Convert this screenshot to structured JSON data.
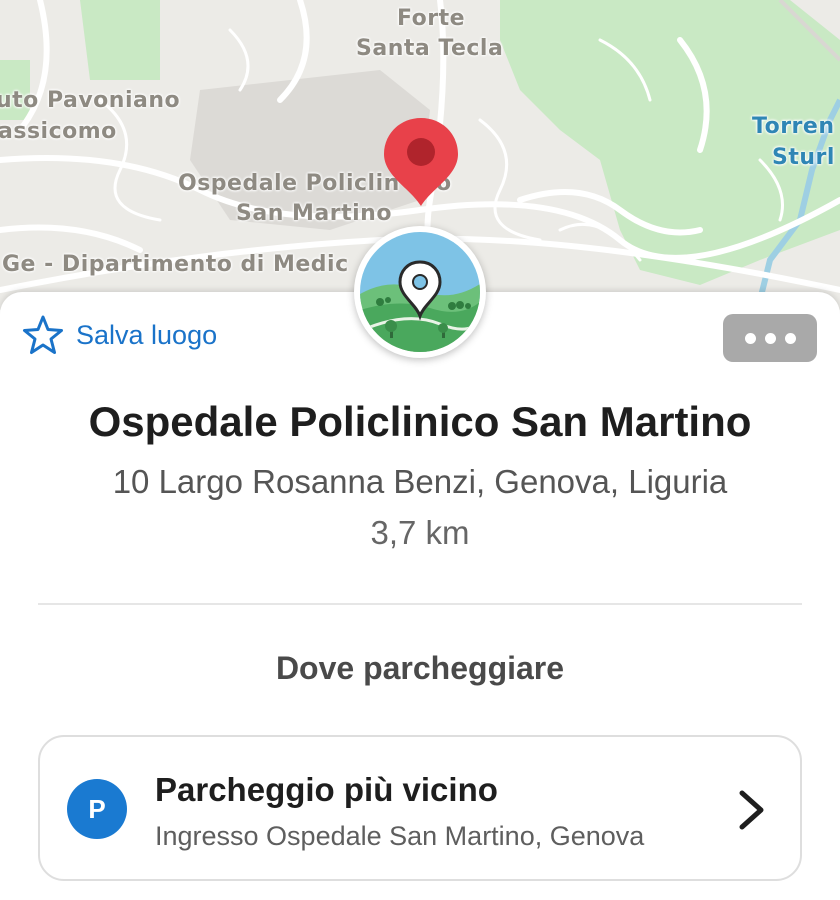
{
  "map": {
    "labels": {
      "forte": "Forte",
      "santa_tecla": "Santa Tecla",
      "pavoniano": "uto Pavoniano",
      "assicomo": "assicomo",
      "torrente": "Torren",
      "sturla": "Sturl",
      "ospedale": "Ospedale Policlin",
      "ospedale_end": "o",
      "san_martino": "San Martino",
      "dipartimento": "Ge - Dipartimento di Medic"
    },
    "colors": {
      "park": "#c9e9c4",
      "water": "#9ecfe3",
      "land": "#ecebe7",
      "pin": "#e8414a"
    }
  },
  "sheet": {
    "save_label": "Salva luogo",
    "title": "Ospedale Policlinico San Martino",
    "address": "10 Largo Rosanna Benzi, Genova, Liguria",
    "distance": "3,7 km",
    "section_title": "Dove parcheggiare",
    "parking": {
      "icon_letter": "P",
      "title": "Parcheggio più vicino",
      "subtitle": "Ingresso Ospedale San Martino, Genova"
    }
  },
  "icons": [
    "star-icon",
    "more-icon",
    "map-pin-icon",
    "place-category-icon",
    "parking-icon",
    "chevron-right-icon"
  ],
  "colors": {
    "accent": "#1a73c9",
    "parking_blue": "#1a7ad1",
    "more_button": "#a9a9a9"
  }
}
